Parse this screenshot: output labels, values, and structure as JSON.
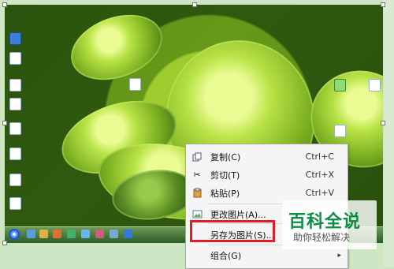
{
  "desktop": {
    "icons": [
      {
        "name": "recycle-bin-icon",
        "label": ""
      },
      {
        "name": "document-icon",
        "label": ""
      },
      {
        "name": "file-icon",
        "label": ""
      },
      {
        "name": "shortcut-icon",
        "label": ""
      }
    ]
  },
  "menu": {
    "items": [
      {
        "label": "复制(C)",
        "shortcut": "Ctrl+C",
        "icon": "copy-icon"
      },
      {
        "label": "剪切(T)",
        "shortcut": "Ctrl+X",
        "icon": "scissors-icon"
      },
      {
        "label": "粘贴(P)",
        "shortcut": "Ctrl+V",
        "icon": "paste-icon"
      },
      {
        "label": "更改图片(A)...",
        "shortcut": "",
        "icon": "change-picture-icon"
      },
      {
        "label": "另存为图片(S)...",
        "shortcut": "",
        "icon": ""
      },
      {
        "label": "组合(G)",
        "shortcut": "",
        "icon": "",
        "submenu_arrow": "▸"
      }
    ]
  },
  "watermark": {
    "main": "百科全说",
    "sub": "助你轻松解决"
  }
}
